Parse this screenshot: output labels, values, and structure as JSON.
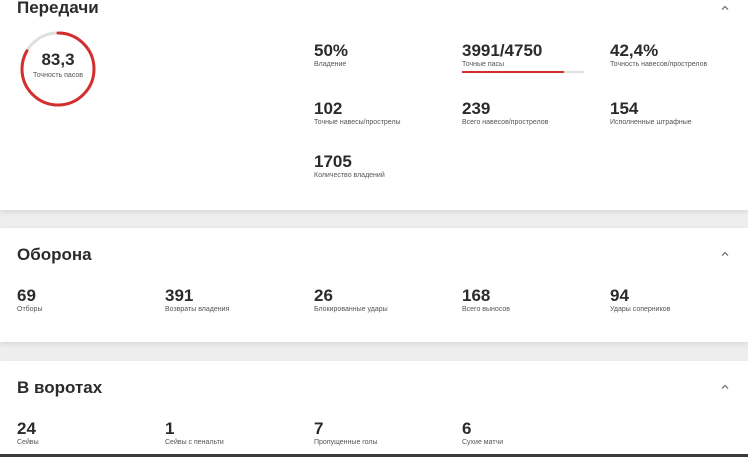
{
  "passing": {
    "title": "Передачи",
    "gauge": {
      "value": "83,3",
      "label": "Точность пасов",
      "fraction": 0.833,
      "color": "#d32f2f"
    },
    "stats": [
      {
        "value": "50%",
        "label": "Владение"
      },
      {
        "value": "3991/4750",
        "label": "Точные пасы",
        "progress": 0.84
      },
      {
        "value": "42,4%",
        "label": "Точность навесов/прострелов"
      },
      {
        "value": "102",
        "label": "Точные навесы/прострелы"
      },
      {
        "value": "239",
        "label": "Всего навесов/прострелов"
      },
      {
        "value": "154",
        "label": "Исполненные штрафные"
      },
      {
        "value": "1705",
        "label": "Количество владений"
      }
    ]
  },
  "defense": {
    "title": "Оборона",
    "stats": [
      {
        "value": "69",
        "label": "Отборы"
      },
      {
        "value": "391",
        "label": "Возвраты владения"
      },
      {
        "value": "26",
        "label": "Блокированные удары"
      },
      {
        "value": "168",
        "label": "Всего выносов"
      },
      {
        "value": "94",
        "label": "Удары соперников"
      }
    ]
  },
  "goalkeeping": {
    "title": "В воротах",
    "stats": [
      {
        "value": "24",
        "label": "Сейвы"
      },
      {
        "value": "1",
        "label": "Сейвы с пенальти"
      },
      {
        "value": "7",
        "label": "Пропущенные голы"
      },
      {
        "value": "6",
        "label": "Сухие матчи"
      }
    ]
  },
  "icons": {
    "collapse": "chevron-up-icon"
  },
  "colors": {
    "accent": "#d32f2f",
    "track": "#e0e0e0"
  }
}
